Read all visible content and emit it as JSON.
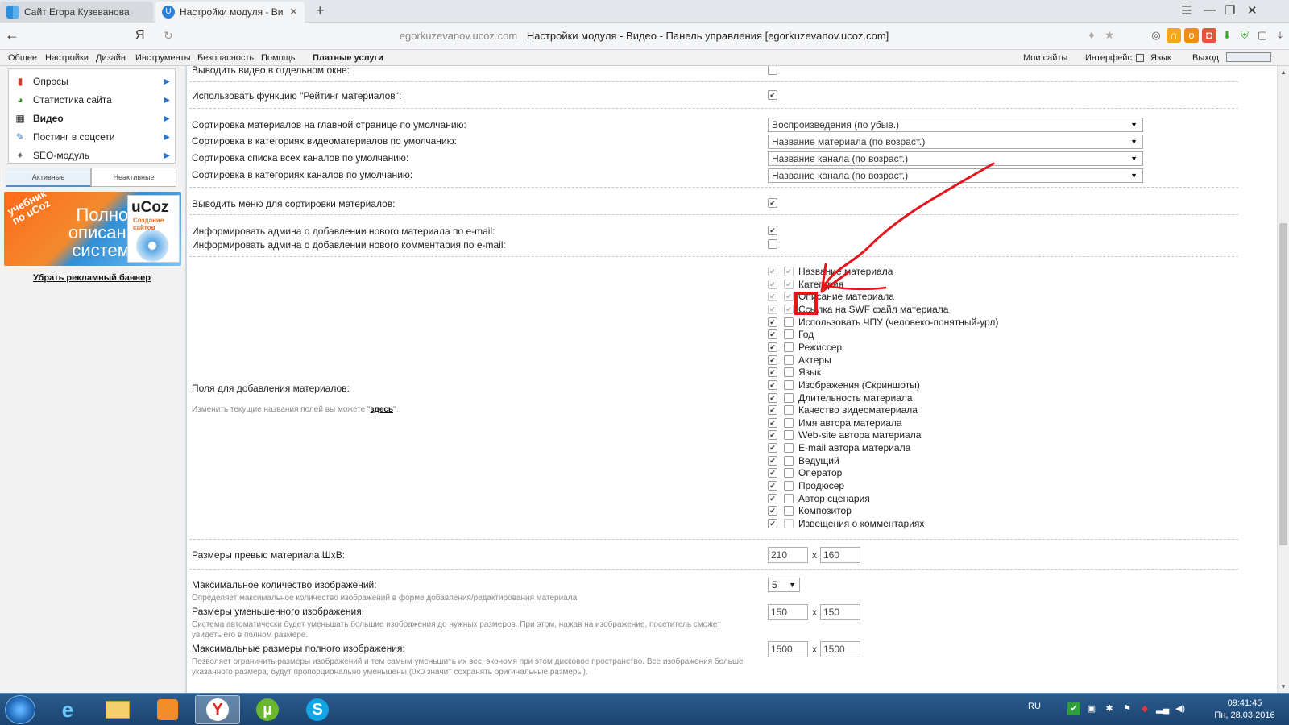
{
  "browser": {
    "tabs": [
      {
        "title": "Сайт Егора Кузеванова - Гла"
      },
      {
        "title": "Настройки модуля - Видео"
      }
    ],
    "new_tab": "+",
    "yandex_logo": "Я",
    "url_domain": "egorkuzevanov.ucoz.com",
    "url_title": "Настройки модуля - Видео - Панель управления [egorkuzevanov.ucoz.com]"
  },
  "menu": {
    "left": [
      "Общее",
      "Настройки",
      "Дизайн",
      "Инструменты",
      "Безопасность",
      "Помощь"
    ],
    "paid": "Платные услуги",
    "right": {
      "my_sites": "Мои сайты",
      "interface": "Интерфейс",
      "language": "Язык",
      "logout": "Выход"
    }
  },
  "sidebar": {
    "items": [
      {
        "label": "Опросы",
        "icon": "poll-icon"
      },
      {
        "label": "Статистика сайта",
        "icon": "stats-icon"
      },
      {
        "label": "Видео",
        "icon": "video-icon",
        "active": true
      },
      {
        "label": "Постинг в соцсети",
        "icon": "social-icon"
      },
      {
        "label": "SEO-модуль",
        "icon": "seo-icon"
      }
    ],
    "tabs": [
      "Активные",
      "Неактивные"
    ],
    "banner": {
      "line1": "учебник",
      "line2": "по uCoz",
      "headline": "Полное описание системы",
      "brand": "uCoz",
      "brand_sub": "Создание сайтов"
    },
    "remove_banner": "Убрать рекламный баннер"
  },
  "settings": {
    "separate_window": "Выводить видео в отдельном окне:",
    "rating": "Использовать функцию \"Рейтинг материалов\":",
    "sort_main": "Сортировка материалов на главной странице по умолчанию:",
    "sort_main_value": "Воспроизведения (по убыв.)",
    "sort_cats": "Сортировка в категориях видеоматериалов по умолчанию:",
    "sort_cats_value": "Название материала (по возраст.)",
    "sort_channels": "Сортировка списка всех каналов по умолчанию:",
    "sort_channels_value": "Название канала (по возраст.)",
    "sort_channel_cats": "Сортировка в категориях каналов по умолчанию:",
    "sort_channel_cats_value": "Название канала (по возраст.)",
    "sort_menu": "Выводить меню для сортировки материалов:",
    "notify_material": "Информировать админа о добавлении нового материала по e-mail:",
    "notify_comment": "Информировать админа о добавлении нового комментария по e-mail:",
    "fields_label": "Поля для добавления материалов:",
    "fields_hint_pre": "Изменить текущие названия полей вы можете \"",
    "fields_hint_link": "здесь",
    "fields_hint_post": "\".",
    "fields": [
      {
        "name": "Название материала",
        "enabled": true,
        "required": true,
        "locked": true
      },
      {
        "name": "Категория",
        "enabled": true,
        "required": true,
        "locked": true
      },
      {
        "name": "Описание материала",
        "enabled": true,
        "required": true,
        "locked": true
      },
      {
        "name": "Ссылка на SWF файл материала",
        "enabled": true,
        "required": true,
        "locked": true
      },
      {
        "name": "Использовать ЧПУ (человеко-понятный-урл)",
        "enabled": true,
        "required": false
      },
      {
        "name": "Год",
        "enabled": true,
        "required": false
      },
      {
        "name": "Режиссер",
        "enabled": true,
        "required": false
      },
      {
        "name": "Актеры",
        "enabled": true,
        "required": false
      },
      {
        "name": "Язык",
        "enabled": true,
        "required": false
      },
      {
        "name": "Изображения (Скриншоты)",
        "enabled": true,
        "required": false
      },
      {
        "name": "Длительность материала",
        "enabled": true,
        "required": false
      },
      {
        "name": "Качество видеоматериала",
        "enabled": true,
        "required": false
      },
      {
        "name": "Имя автора материала",
        "enabled": true,
        "required": false
      },
      {
        "name": "Web-site автора материала",
        "enabled": true,
        "required": false
      },
      {
        "name": "E-mail автора материала",
        "enabled": true,
        "required": false
      },
      {
        "name": "Ведущий",
        "enabled": true,
        "required": false
      },
      {
        "name": "Оператор",
        "enabled": true,
        "required": false
      },
      {
        "name": "Продюсер",
        "enabled": true,
        "required": false
      },
      {
        "name": "Автор сценария",
        "enabled": true,
        "required": false
      },
      {
        "name": "Композитор",
        "enabled": true,
        "required": false
      },
      {
        "name": "Извещения о комментариях",
        "enabled": true,
        "required": false,
        "locked": true
      }
    ],
    "preview_size_label": "Размеры превью материала ШхВ:",
    "preview_w": "210",
    "preview_h": "160",
    "max_images_label": "Максимальное количество изображений:",
    "max_images_value": "5",
    "max_images_hint": "Определяет максимальное количество изображений в форме добавления/редактирования материала.",
    "thumb_label": "Размеры уменьшенного изображения:",
    "thumb_hint": "Система автоматически будет уменьшать большие изображения до нужных размеров. При этом, нажав на изображение, посетитель сможет увидеть его в полном размере.",
    "thumb_w": "150",
    "thumb_h": "150",
    "full_label": "Максимальные размеры полного изображения:",
    "full_hint": "Позволяет ограничить размеры изображений и тем самым уменьшить их вес, экономя при этом дисковое пространство. Все изображения больше указанного размера, будут пропорционально уменьшены (0х0 значит сохранять оригинальные размеры).",
    "full_w": "1500",
    "full_h": "1500",
    "times": "x"
  },
  "taskbar": {
    "lang": "RU",
    "time": "09:41:45",
    "date": "Пн, 28.03.2016"
  },
  "colors": {
    "annotation": "#e8141b",
    "accent": "#2e74c8"
  }
}
